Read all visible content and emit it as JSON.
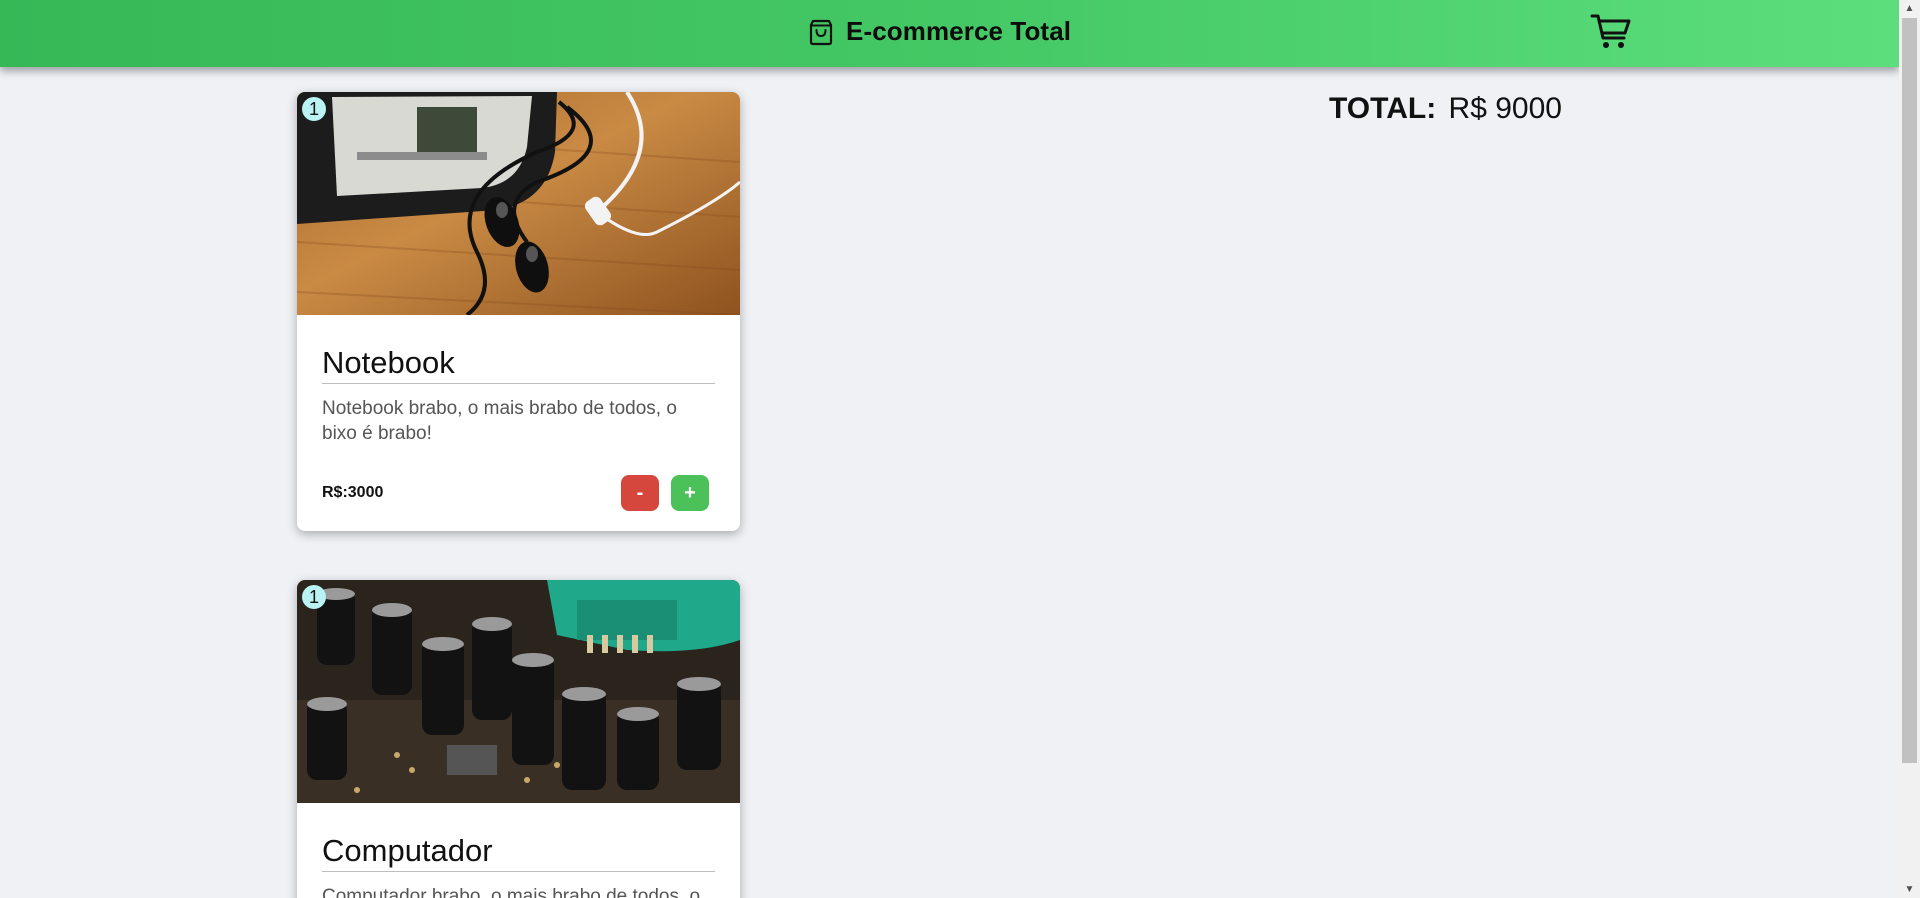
{
  "header": {
    "brand_icon": "shopping-bag-icon",
    "title": "E-commerce Total",
    "cart_icon": "shopping-cart-icon",
    "background_from": "#37b857",
    "background_to": "#5cde7c"
  },
  "summary": {
    "label": "TOTAL:",
    "value": "R$ 9000"
  },
  "products": [
    {
      "quantity": "1",
      "image": "phone-with-earphones-photo",
      "name": "Notebook",
      "description": "Notebook brabo, o mais brabo de todos, o bixo é brabo!",
      "price": "R$:3000",
      "minus_label": "-",
      "plus_label": "+"
    },
    {
      "quantity": "1",
      "image": "circuit-board-capacitors-photo",
      "name": "Computador",
      "description": "Computador brabo, o mais brabo de todos, o bixo é brabo!"
    }
  ],
  "colors": {
    "page_background": "#eff1f5",
    "minus_button": "#d5473d",
    "plus_button": "#4cc059",
    "quantity_badge": "#b9f3f3"
  }
}
